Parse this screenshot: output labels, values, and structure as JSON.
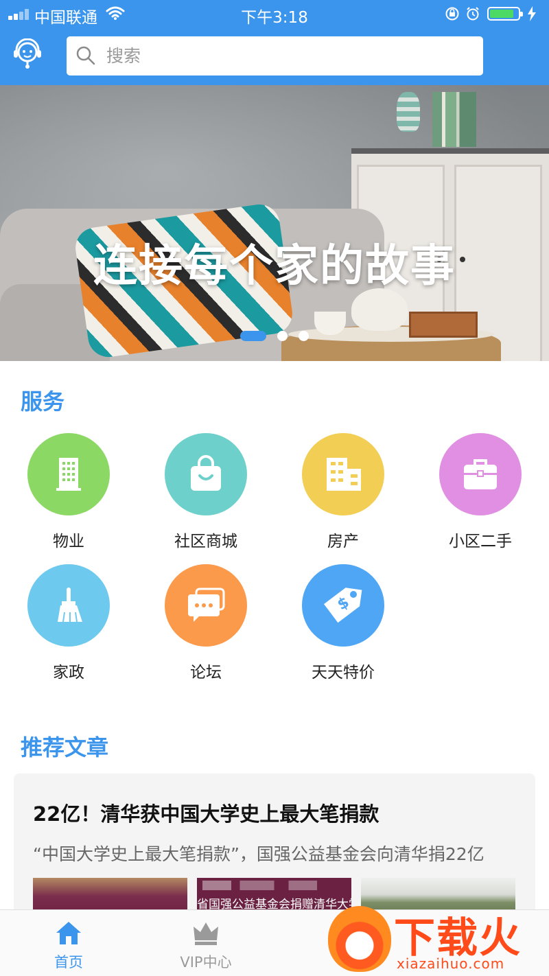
{
  "status_bar": {
    "carrier": "中国联通",
    "time": "下午3:18",
    "battery_level": 0.9
  },
  "header": {
    "support_icon": "customer-service-icon",
    "search": {
      "placeholder": "搜索",
      "icon": "search-icon"
    }
  },
  "banner": {
    "title": "连接每个家的故事",
    "slides": 3,
    "active_slide": 1
  },
  "services": {
    "title": "服务",
    "items": [
      {
        "label": "物业",
        "icon": "building-icon",
        "color": "#8cd865"
      },
      {
        "label": "社区商城",
        "icon": "shopping-bag-icon",
        "color": "#6dd0cb"
      },
      {
        "label": "房产",
        "icon": "office-building-icon",
        "color": "#f3ce55"
      },
      {
        "label": "小区二手",
        "icon": "briefcase-icon",
        "color": "#e08fe3"
      },
      {
        "label": "家政",
        "icon": "broom-icon",
        "color": "#6dcaee"
      },
      {
        "label": "论坛",
        "icon": "chat-bubbles-icon",
        "color": "#fc9a4b"
      },
      {
        "label": "天天特价",
        "icon": "price-tag-icon",
        "color": "#4ea6f5"
      }
    ]
  },
  "articles": {
    "title": "推荐文章",
    "items": [
      {
        "title": "22亿！清华获中国大学史上最大笔捐款",
        "summary": "“中国大学史上最大笔捐款”，国强公益基金会向清华捐22亿",
        "image_caption": "省国强公益基金会捐赠清华大学"
      }
    ]
  },
  "tabbar": {
    "items": [
      {
        "label": "首页",
        "icon": "home-icon",
        "active": true
      },
      {
        "label": "VIP中心",
        "icon": "crown-icon",
        "active": false
      }
    ]
  },
  "watermark": {
    "brand": "下载火",
    "url": "xiazaihuo.com"
  },
  "colors": {
    "primary": "#3c95ec",
    "section_title": "#3c95ec",
    "watermark": "#ff4a1a"
  }
}
